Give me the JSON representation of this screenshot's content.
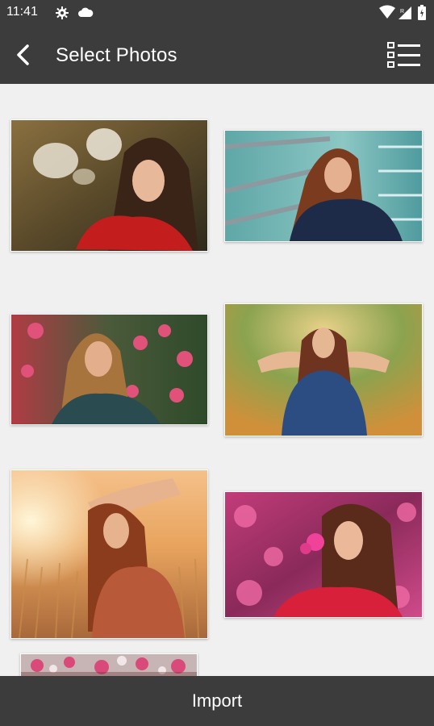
{
  "status_bar": {
    "time": "11:41",
    "icons": [
      "gear-icon",
      "cloud-icon",
      "wifi-icon",
      "signal-icon",
      "battery-icon"
    ]
  },
  "app_bar": {
    "title": "Select Photos",
    "back_icon": "chevron-left-icon",
    "menu_icon": "checklist-icon"
  },
  "photos": [
    {
      "subject": "woman in red sweater among white flowers"
    },
    {
      "subject": "woman in navy jacket with scarf by railing"
    },
    {
      "subject": "woman among pink blossoms"
    },
    {
      "subject": "woman in denim shirt with arms raised in forest"
    },
    {
      "subject": "woman in floral dress in golden wheat field"
    },
    {
      "subject": "woman in red top holding pink flowers"
    },
    {
      "subject": "blossoms and branches"
    }
  ],
  "bottom_bar": {
    "import_label": "Import"
  },
  "colors": {
    "bar_background": "#3c3c3c",
    "content_background": "#f0f0f0",
    "text_on_bar": "#ffffff"
  }
}
